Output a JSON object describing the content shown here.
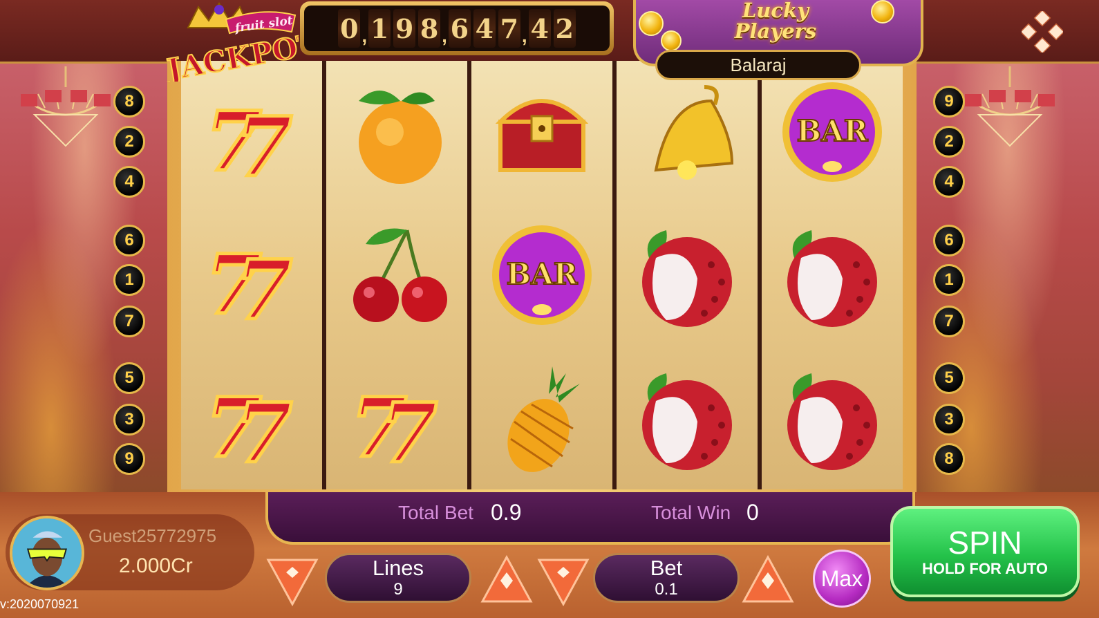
{
  "jackpot": {
    "logo_top": "fruit slot",
    "logo_main": "JACKPOT",
    "digits": [
      "0",
      ",",
      "1",
      "9",
      "8",
      ",",
      "6",
      "4",
      "7",
      ",",
      "4",
      "2"
    ]
  },
  "lucky_players": {
    "title_line1": "Lucky",
    "title_line2": "Players",
    "name": "Balaraj"
  },
  "lines_left": [
    "8",
    "2",
    "4",
    "6",
    "1",
    "7",
    "5",
    "3",
    "9"
  ],
  "lines_right": [
    "9",
    "2",
    "4",
    "6",
    "1",
    "7",
    "5",
    "3",
    "8"
  ],
  "reels": [
    [
      "seven",
      "seven",
      "seven"
    ],
    [
      "orange",
      "cherry",
      "seven"
    ],
    [
      "chest",
      "bar",
      "pineapple"
    ],
    [
      "bell",
      "lychee",
      "lychee"
    ],
    [
      "bar",
      "lychee",
      "lychee"
    ]
  ],
  "bar_text": "BAR",
  "info": {
    "total_bet_label": "Total Bet",
    "total_bet_value": "0.9",
    "total_win_label": "Total Win",
    "total_win_value": "0"
  },
  "player": {
    "name": "Guest25772975",
    "balance": "2.000Cr",
    "version": "v:2020070921"
  },
  "controls": {
    "lines_label": "Lines",
    "lines_value": "9",
    "bet_label": "Bet",
    "bet_value": "0.1",
    "max_label": "Max",
    "spin_label": "SPIN",
    "spin_sub": "HOLD FOR AUTO"
  },
  "colors": {
    "spin": "#24c24a",
    "max": "#b62cc2",
    "gold": "#e7b651",
    "line_badge_text": "#ffd04a"
  }
}
